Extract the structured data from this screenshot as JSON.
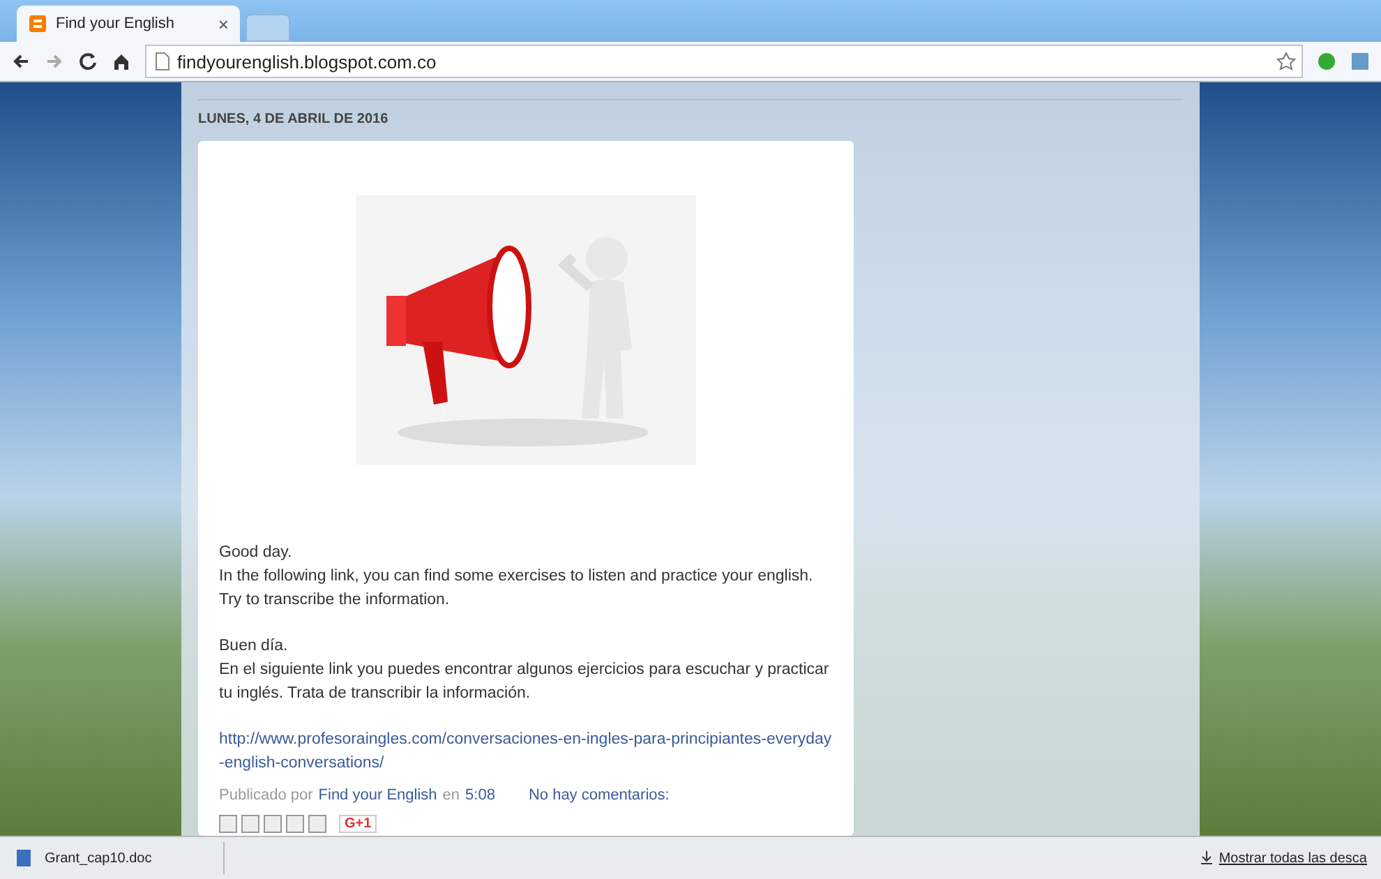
{
  "browser": {
    "tab": {
      "title": "Find your English",
      "close": "×"
    },
    "address": "findyourenglish.blogspot.com.co"
  },
  "post": {
    "date": "LUNES, 4 DE ABRIL DE 2016",
    "paragraphs": [
      {
        "lines": [
          "Good day.",
          "In the following link, you can find some exercises to listen and practice your english. Try to transcribe the information."
        ]
      },
      {
        "lines": [
          "Buen día.",
          "En el siguiente link you puedes encontrar algunos ejercicios para escuchar y practicar tu inglés. Trata de transcribir la información."
        ]
      }
    ],
    "link": "http://www.profesoraingles.com/conversaciones-en-ingles-para-principiantes-everyday-english-conversations/",
    "footer": {
      "published_by": "Publicado por",
      "author": "Find your English",
      "at": "en",
      "time": "5:08",
      "comments": "No hay comentarios:"
    },
    "gplus": "G+1"
  },
  "downloads": {
    "file": "Grant_cap10.doc",
    "show_all": "Mostrar todas las desca"
  }
}
